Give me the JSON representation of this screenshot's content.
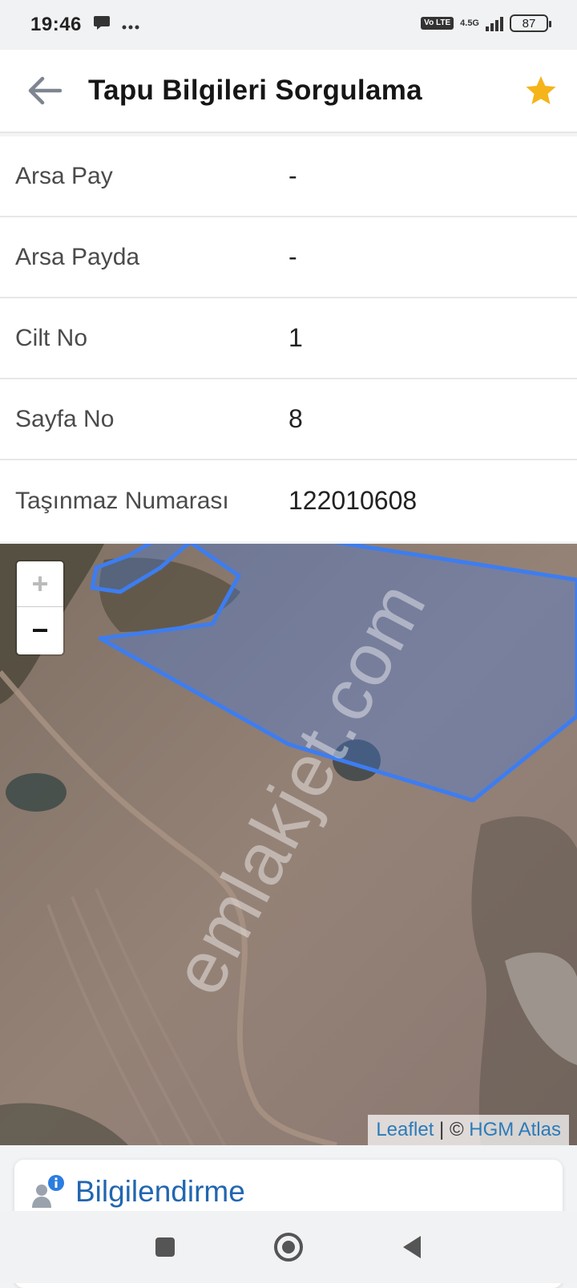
{
  "status_bar": {
    "time": "19:46",
    "network": "4.5G",
    "volte": "Vo LTE",
    "battery": "87"
  },
  "app_bar": {
    "title": "Tapu Bilgileri Sorgulama"
  },
  "info_rows": [
    {
      "label": "Arsa Pay",
      "value": "-"
    },
    {
      "label": "Arsa Payda",
      "value": "-"
    },
    {
      "label": "Cilt No",
      "value": "1"
    },
    {
      "label": "Sayfa No",
      "value": "8"
    },
    {
      "label": "Taşınmaz Numarası",
      "value": "122010608"
    }
  ],
  "map": {
    "zoom_in": "+",
    "zoom_out": "−",
    "attribution_leaflet": "Leaflet",
    "attribution_separator": " | © ",
    "attribution_source": "HGM Atlas",
    "watermark": "emlakjet.com",
    "parcel_color": "#3d7df0"
  },
  "card": {
    "title": "Bilgilendirme"
  }
}
